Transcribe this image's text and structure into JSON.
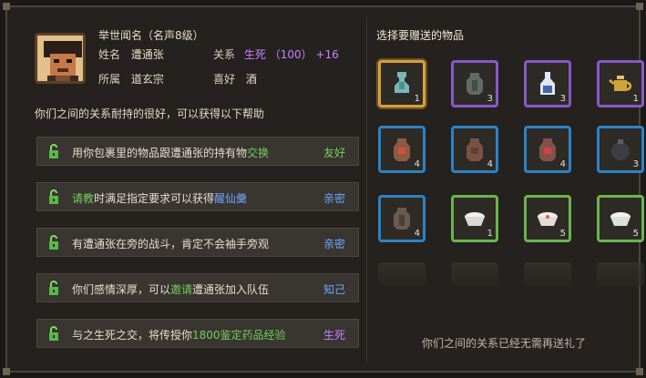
{
  "character": {
    "title": "举世闻名（名声8级）",
    "name_label": "姓名",
    "name_value": "遭通张",
    "relation_label": "关系",
    "relation_value": "生死",
    "relation_score": "（100）",
    "relation_bonus": "+16",
    "sect_label": "所属",
    "sect_value": "道玄宗",
    "hobby_label": "喜好",
    "hobby_value": "酒"
  },
  "description": "你们之间的关系耐持的很好，可以获得以下帮助",
  "help_rows": [
    {
      "text_prefix": "用你包裹里的物品跟遭通张的持有物",
      "highlight": "交换",
      "text_suffix": "",
      "status": "友好",
      "status_color": "#73cf5d"
    },
    {
      "text_prefix": "",
      "highlight": "请教",
      "text_suffix": "时满足指定要求可以获得",
      "highlight2": "醒仙羹",
      "status": "亲密",
      "status_color": "#6fa6ff"
    },
    {
      "text_prefix": "有遭通张在旁的战斗，肯定不会袖手旁观",
      "highlight": "",
      "text_suffix": "",
      "status": "亲密",
      "status_color": "#6fa6ff"
    },
    {
      "text_prefix": "你们感情深厚，可以",
      "highlight": "邀请",
      "text_suffix": "遭通张加入队伍",
      "status": "知己",
      "status_color": "#6fa6ff"
    },
    {
      "text_prefix": "与之生死之交，将传授你",
      "highlight": "1800鉴定药品经验",
      "text_suffix": "",
      "status": "生死",
      "status_color": "#c983ff"
    }
  ],
  "gift": {
    "title": "选择要赠送的物品",
    "items": [
      {
        "icon": "vase-icon",
        "quantity": "1",
        "rarity": "selected"
      },
      {
        "icon": "jar-icon",
        "quantity": "3",
        "rarity": "purple"
      },
      {
        "icon": "bottle-icon",
        "quantity": "3",
        "rarity": "purple"
      },
      {
        "icon": "teapot-icon",
        "quantity": "1",
        "rarity": "purple"
      },
      {
        "icon": "wine-jar-icon",
        "quantity": "4",
        "rarity": "blue"
      },
      {
        "icon": "wine-jar-icon",
        "quantity": "4",
        "rarity": "blue"
      },
      {
        "icon": "wine-jar-icon",
        "quantity": "4",
        "rarity": "blue"
      },
      {
        "icon": "round-jar-icon",
        "quantity": "3",
        "rarity": "blue"
      },
      {
        "icon": "jar-icon",
        "quantity": "4",
        "rarity": "blue"
      },
      {
        "icon": "bowl-icon",
        "quantity": "1",
        "rarity": "green"
      },
      {
        "icon": "bowl-icon",
        "quantity": "5",
        "rarity": "green"
      },
      {
        "icon": "bowl-icon",
        "quantity": "5",
        "rarity": "green"
      }
    ],
    "footer": "你们之间的关系已经无需再送礼了"
  }
}
